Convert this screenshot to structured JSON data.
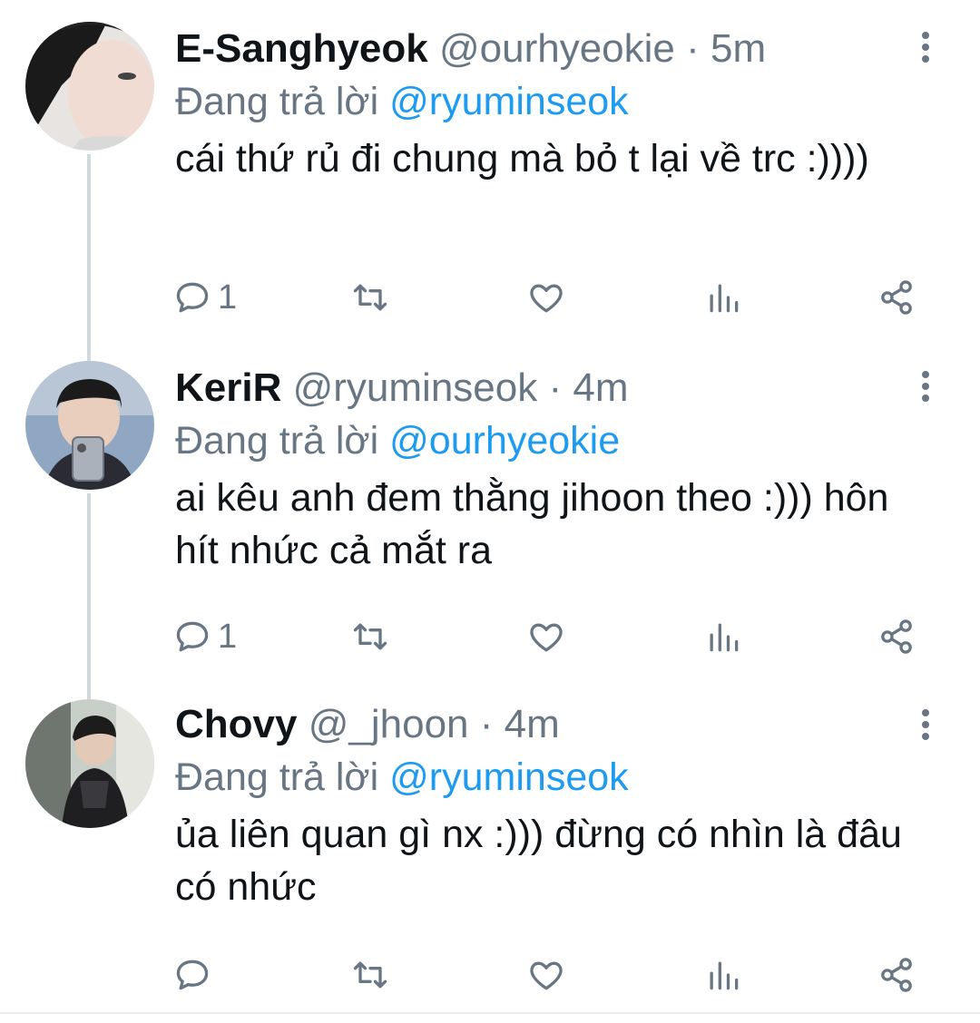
{
  "tweets": [
    {
      "name": "E-Sanghyeok",
      "handle": "@ourhyeokie",
      "separator": "·",
      "time": "5m",
      "reply_prefix": "Đang trả lời",
      "reply_to": "@ryuminseok",
      "text": "cái thứ rủ đi chung mà bỏ t lại về trc :))))",
      "reply_count": "1"
    },
    {
      "name": "KeriR",
      "handle": "@ryuminseok",
      "separator": "·",
      "time": "4m",
      "reply_prefix": "Đang trả lời",
      "reply_to": "@ourhyeokie",
      "text": "ai kêu anh đem thằng jihoon theo :))) hôn hít nhức cả mắt ra",
      "reply_count": "1"
    },
    {
      "name": "Chovy",
      "handle": "@_jhoon",
      "separator": "·",
      "time": "4m",
      "reply_prefix": "Đang trả lời",
      "reply_to": "@ryuminseok",
      "text": "ủa liên quan gì nx :))) đừng có nhìn là đâu có nhức",
      "reply_count": ""
    }
  ],
  "colors": {
    "text": "#0f1419",
    "secondary": "#687684",
    "mention": "#1d9bf0",
    "thread_line": "#cfd9de"
  },
  "icons": [
    "reply-icon",
    "retweet-icon",
    "like-icon",
    "analytics-icon",
    "share-icon",
    "more-options-icon"
  ]
}
